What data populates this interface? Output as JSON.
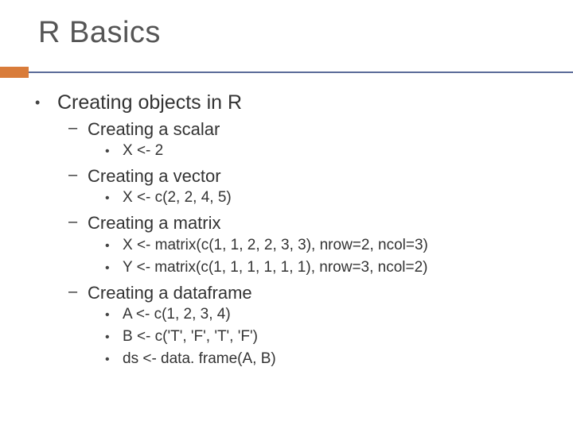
{
  "title": "R Basics",
  "heading": "Creating objects in R",
  "sections": [
    {
      "label": "Creating a scalar",
      "code": [
        "X <- 2"
      ]
    },
    {
      "label": "Creating a vector",
      "code": [
        "X <- c(2, 2, 4, 5)"
      ]
    },
    {
      "label": "Creating a matrix",
      "code": [
        "X <- matrix(c(1, 1, 2, 2, 3, 3), nrow=2, ncol=3)",
        "Y <- matrix(c(1, 1, 1, 1, 1, 1), nrow=3, ncol=2)"
      ]
    },
    {
      "label": "Creating a dataframe",
      "code": [
        "A <- c(1, 2, 3, 4)",
        "B <- c('T', 'F', 'T', 'F')",
        "ds <- data. frame(A, B)"
      ]
    }
  ],
  "colors": {
    "accent": "#d97c3a",
    "rule": "#5b6b99"
  }
}
